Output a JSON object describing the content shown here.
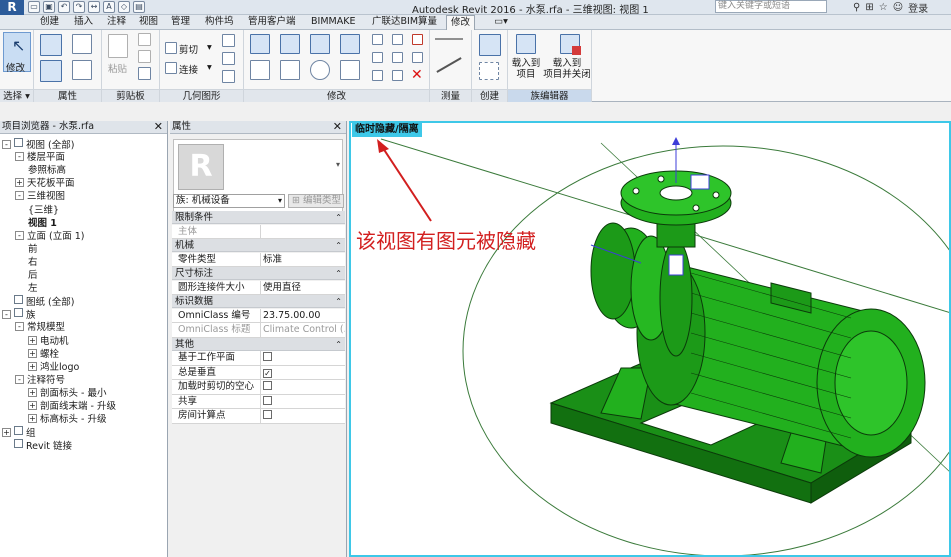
{
  "titlebar": {
    "app_button": "R",
    "title": "Autodesk Revit 2016 -   水泵.rfa - 三维视图: 视图 1",
    "search_placeholder": "键入关键字或短语",
    "login": "登录",
    "qat_icons": [
      "open-icon",
      "save-icon",
      "undo-icon",
      "redo-icon",
      "measure-icon",
      "text-icon",
      "3d-view-icon",
      "switch-window-icon"
    ]
  },
  "tabs": [
    "创建",
    "插入",
    "注释",
    "视图",
    "管理",
    "构件坞",
    "管用客户端",
    "BIMMAKE",
    "广联达BIM算量",
    "修改"
  ],
  "ribbon": {
    "select": {
      "button": "修改",
      "panel": "选择"
    },
    "properties_panel": "属性",
    "clipboard": {
      "paste": "粘贴",
      "panel": "剪贴板"
    },
    "geometry": {
      "cut": "剪切",
      "join": "连接",
      "panel": "几何图形"
    },
    "modify_panel": "修改",
    "measure_panel": "测量",
    "create_panel": "创建",
    "family_editor": {
      "load_to_project": "载入到\n项目",
      "load_close": "载入到\n项目并关闭",
      "panel": "族编辑器"
    }
  },
  "project_browser": {
    "title": "项目浏览器 - 水泵.rfa",
    "items": [
      {
        "label": "视图 (全部)",
        "level": 0,
        "toggle": "-",
        "icon": true
      },
      {
        "label": "楼层平面",
        "level": 1,
        "toggle": "-"
      },
      {
        "label": "参照标高",
        "level": 2
      },
      {
        "label": "天花板平面",
        "level": 1,
        "toggle": "+"
      },
      {
        "label": "三维视图",
        "level": 1,
        "toggle": "-"
      },
      {
        "label": "{三维}",
        "level": 2
      },
      {
        "label": "视图 1",
        "level": 2,
        "bold": true
      },
      {
        "label": "立面 (立面 1)",
        "level": 1,
        "toggle": "-"
      },
      {
        "label": "前",
        "level": 2
      },
      {
        "label": "右",
        "level": 2
      },
      {
        "label": "后",
        "level": 2
      },
      {
        "label": "左",
        "level": 2
      },
      {
        "label": "图纸 (全部)",
        "level": 0,
        "icon": true
      },
      {
        "label": "族",
        "level": 0,
        "toggle": "-",
        "icon": true
      },
      {
        "label": "常规模型",
        "level": 1,
        "toggle": "-"
      },
      {
        "label": "电动机",
        "level": 2,
        "toggle": "+"
      },
      {
        "label": "螺栓",
        "level": 2,
        "toggle": "+"
      },
      {
        "label": "鸿业logo",
        "level": 2,
        "toggle": "+"
      },
      {
        "label": "注释符号",
        "level": 1,
        "toggle": "-"
      },
      {
        "label": "剖面标头 - 最小",
        "level": 2,
        "toggle": "+"
      },
      {
        "label": "剖面线末端 - 升级",
        "level": 2,
        "toggle": "+"
      },
      {
        "label": "标高标头 - 升级",
        "level": 2,
        "toggle": "+"
      },
      {
        "label": "组",
        "level": 0,
        "toggle": "+",
        "icon": true
      },
      {
        "label": "Revit 链接",
        "level": 0,
        "icon": true
      }
    ]
  },
  "properties": {
    "title": "属性",
    "family": "族: 机械设备",
    "edit_type": "编辑类型",
    "sections": [
      {
        "title": "限制条件",
        "rows": [
          {
            "k": "主体",
            "v": "",
            "dim": true
          }
        ]
      },
      {
        "title": "机械",
        "rows": [
          {
            "k": "零件类型",
            "v": "标准"
          }
        ]
      },
      {
        "title": "尺寸标注",
        "rows": [
          {
            "k": "圆形连接件大小",
            "v": "使用直径"
          }
        ]
      },
      {
        "title": "标识数据",
        "rows": [
          {
            "k": "OmniClass 编号",
            "v": "23.75.00.00"
          },
          {
            "k": "OmniClass 标题",
            "v": "Climate Control (...",
            "dim": true
          }
        ]
      },
      {
        "title": "其他",
        "rows": [
          {
            "k": "基于工作平面",
            "check": false
          },
          {
            "k": "总是垂直",
            "check": true
          },
          {
            "k": "加载时剪切的空心",
            "check": false
          },
          {
            "k": "共享",
            "check": false
          },
          {
            "k": "房间计算点",
            "check": false
          }
        ]
      }
    ]
  },
  "viewport": {
    "temp_hide_label": "临时隐藏/隔离",
    "annotation": "该视图有图元被隐藏",
    "annotation_color": "#d21f1f",
    "highlight_color": "#3ec8e8",
    "model_color": "#22b01e"
  }
}
